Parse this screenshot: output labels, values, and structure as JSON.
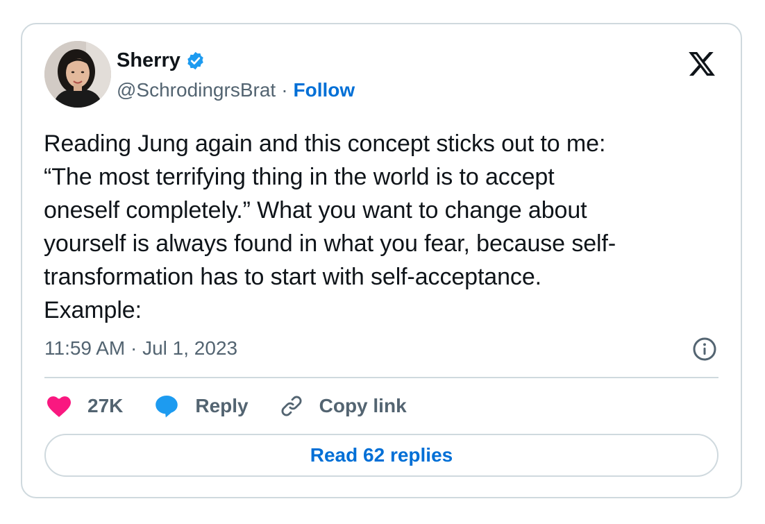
{
  "author": {
    "display_name": "Sherry",
    "handle": "@SchrodingrsBrat",
    "separator": "·",
    "follow_label": "Follow",
    "verified": true
  },
  "tweet": {
    "text": "Reading Jung again and this concept sticks out to me:\n“The most terrifying thing in the world is to accept\noneself completely.” What you want to change about\nyourself is always found in what you fear, because self-\ntransformation has to start with self-acceptance.\nExample:",
    "timestamp": "11:59 AM · Jul 1, 2023"
  },
  "actions": {
    "likes_count": "27K",
    "reply_label": "Reply",
    "copy_link_label": "Copy link"
  },
  "footer": {
    "read_replies_label": "Read 62 replies"
  },
  "icons": {
    "logo": "x-logo-icon",
    "verified": "verified-badge-icon",
    "info": "info-icon",
    "like": "heart-icon",
    "reply": "speech-bubble-icon",
    "copy_link": "link-icon"
  },
  "colors": {
    "link_blue": "#006fd6",
    "verified_blue": "#1d9bf0",
    "heart_pink": "#f91880",
    "muted_text": "#536471",
    "border": "#cfd9de"
  }
}
